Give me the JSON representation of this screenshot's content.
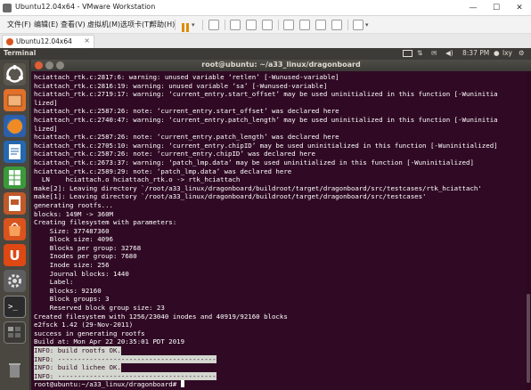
{
  "window": {
    "title": "Ubuntu12.04x64 - VMware Workstation",
    "minimize_glyph": "—",
    "maximize_glyph": "☐",
    "close_glyph": "✕"
  },
  "menubar": {
    "items": [
      "文件(F)",
      "编辑(E)",
      "查看(V)",
      "虚拟机(M)",
      "选项卡(T)",
      "帮助(H)"
    ]
  },
  "tabs": [
    {
      "label": "Ubuntu12.04x64"
    }
  ],
  "ubuntu_panel": {
    "app_name": "Terminal",
    "clock": "8:37 PM",
    "user": "lxy"
  },
  "terminal": {
    "title": "root@ubuntu: ~/a33_linux/dragonboard",
    "lines": [
      "hciattach_rtk.c:2817:6: warning: unused variable ‘retlen’ [-Wunused-variable]",
      "hciattach_rtk.c:2816:19: warning: unused variable ‘sa’ [-Wunused-variable]",
      "hciattach_rtk.c:2719:17: warning: ‘current_entry.start_offset’ may be used uninitialized in this function [-Wuninitia",
      "lized]",
      "hciattach_rtk.c:2587:26: note: ‘current_entry.start_offset’ was declared here",
      "hciattach_rtk.c:2740:47: warning: ‘current_entry.patch_length’ may be used uninitialized in this function [-Wuninitia",
      "lized]",
      "hciattach_rtk.c:2587:26: note: ‘current_entry.patch_length’ was declared here",
      "hciattach_rtk.c:2705:10: warning: ‘current_entry.chipID’ may be used uninitialized in this function [-Wuninitialized]",
      "hciattach_rtk.c:2587:26: note: ‘current_entry.chipID’ was declared here",
      "hciattach_rtk.c:2673:37: warning: ‘patch_lmp.data’ may be used uninitialized in this function [-Wuninitialized]",
      "hciattach_rtk.c:2589:29: note: ‘patch_lmp.data’ was declared here",
      "  LN    hciattach.o hciattach_rtk.o -> rtk_hciattach",
      "make[2]: Leaving directory `/root/a33_linux/dragonboard/buildroot/target/dragonboard/src/testcases/rtk_hciattach'",
      "make[1]: Leaving directory `/root/a33_linux/dragonboard/buildroot/target/dragonboard/src/testcases'",
      "generating rootfs...",
      "blocks: 149M -> 360M",
      "Creating filesystem with parameters:",
      "    Size: 377487360",
      "    Block size: 4096",
      "    Blocks per group: 32768",
      "    Inodes per group: 7680",
      "    Inode size: 256",
      "    Journal blocks: 1440",
      "    Label:",
      "    Blocks: 92160",
      "    Block groups: 3",
      "    Reserved block group size: 23",
      "Created filesystem with 1256/23040 inodes and 40919/92160 blocks",
      "e2fsck 1.42 (29-Nov-2011)",
      "success in generating rootfs",
      "Build at: Mon Apr 22 20:35:01 PDT 2019"
    ],
    "highlighted_lines": [
      "INFO: build rootfs OK.",
      "INFO: ----------------------------------------",
      "INFO: build lichee OK.",
      "INFO: ----------------------------------------"
    ],
    "prompt": "root@ubuntu:~/a33_linux/dragonboard#"
  },
  "launcher": {
    "icons": [
      "ubuntu-dash-icon",
      "files-icon",
      "firefox-icon",
      "writer-icon",
      "calc-icon",
      "impress-icon",
      "software-center-icon",
      "ubuntu-one-icon",
      "system-settings-icon",
      "terminal-icon",
      "workspace-switcher-icon",
      "trash-icon"
    ]
  },
  "colors": {
    "terminal_bg": "#300a24",
    "ubuntu_panel": "#3c3b37",
    "close_orange": "#e25d33"
  }
}
